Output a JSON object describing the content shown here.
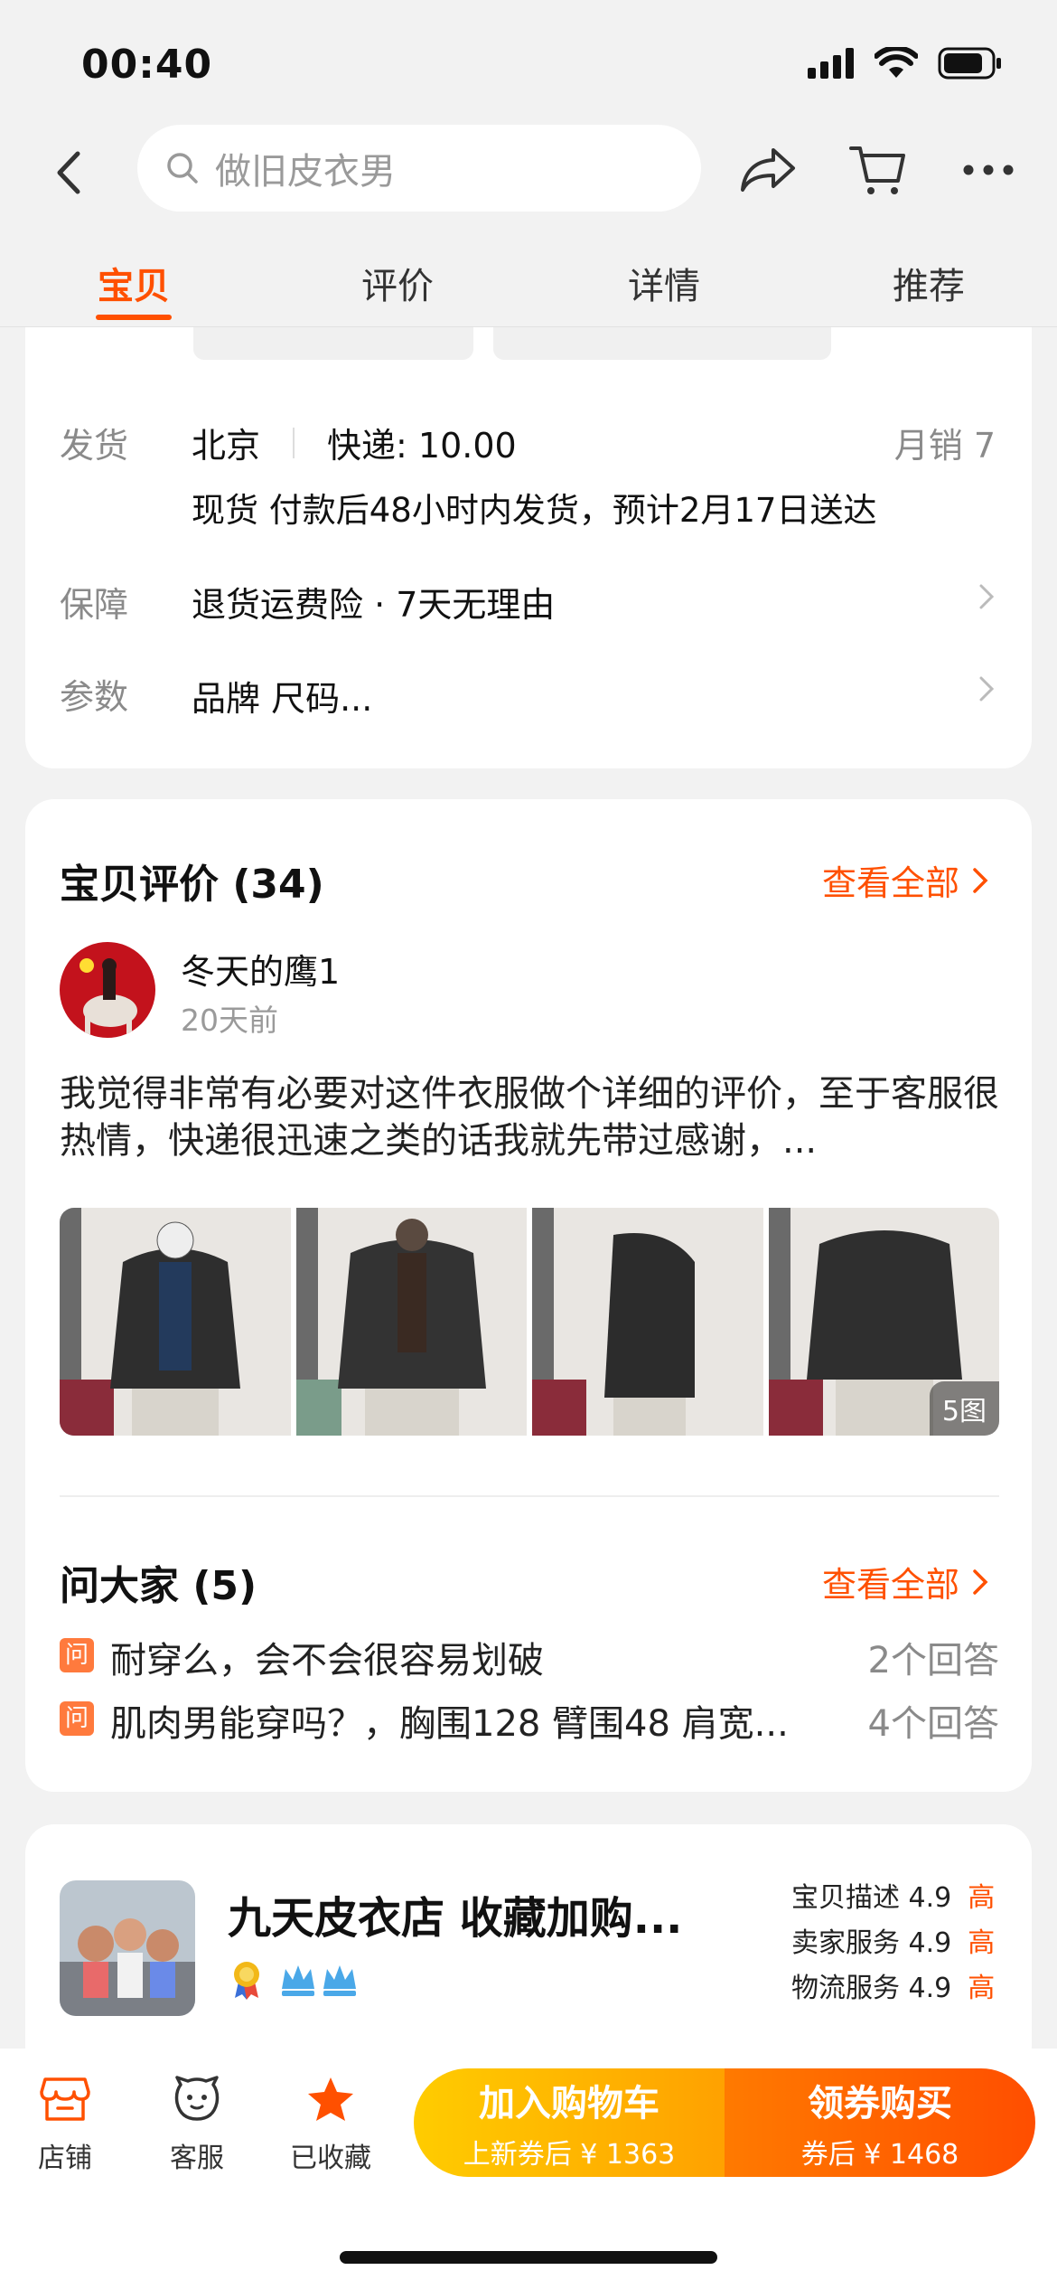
{
  "status_bar": {
    "time": "00:40"
  },
  "search": {
    "placeholder": "做旧皮衣男"
  },
  "tabs": [
    {
      "label": "宝贝",
      "active": true
    },
    {
      "label": "评价",
      "active": false
    },
    {
      "label": "详情",
      "active": false
    },
    {
      "label": "推荐",
      "active": false
    }
  ],
  "shipping": {
    "label": "发货",
    "origin": "北京",
    "express": "快递: 10.00",
    "monthly_sales": "月销 7",
    "detail": "现货 付款后48小时内发货，预计2月17日送达"
  },
  "guarantee": {
    "label": "保障",
    "value": "退货运费险 · 7天无理由"
  },
  "params": {
    "label": "参数",
    "value": "品牌 尺码..."
  },
  "reviews": {
    "title": "宝贝评价 (34)",
    "see_all": "查看全部",
    "reviewer": "冬天的鹰1",
    "time": "20天前",
    "text": "我觉得非常有必要对这件衣服做个详细的评价，至于客服很热情，快递很迅速之类的话我就先带过感谢，...",
    "photo_count": "5图"
  },
  "qa": {
    "title": "问大家 (5)",
    "see_all": "查看全部",
    "badge": "问",
    "items": [
      {
        "question": "耐穿么，会不会很容易划破",
        "answers": "2个回答"
      },
      {
        "question": "肌肉男能穿吗？，胸围128 臂围48 肩宽...",
        "answers": "4个回答"
      }
    ]
  },
  "shop": {
    "name": "九天皮衣店  收藏加购...",
    "scores": [
      {
        "label": "宝贝描述 4.9",
        "level": "高"
      },
      {
        "label": "卖家服务 4.9",
        "level": "高"
      },
      {
        "label": "物流服务 4.9",
        "level": "高"
      }
    ]
  },
  "bottom_bar": {
    "store": "店铺",
    "service": "客服",
    "favorited": "已收藏",
    "add_cart": "加入购物车",
    "add_cart_sub": "上新券后 ¥ 1363",
    "buy": "领券购买",
    "buy_sub": "券后 ¥ 1468"
  },
  "colors": {
    "accent": "#ff5000",
    "cart_yellow": "#ffb400",
    "buy_orange": "#ff5a00"
  }
}
